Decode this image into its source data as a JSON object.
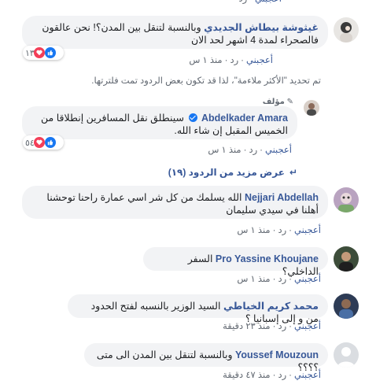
{
  "common": {
    "like": "أعجبني",
    "reply": "رد",
    "dot": "·"
  },
  "comments": [
    {
      "name": "غيثوشة بيطاش الجديدي",
      "text": "وبالنسبة لتنقل بين المدن؟! نحن عالقون فالصحراء لمدة 4 اشهر لحد الان",
      "time": "منذ ١ س",
      "reactions": "١٣"
    },
    {
      "name": "Abdelkader Amara",
      "badge": "مؤلف",
      "text": "سينطلق نقل المسافرين إنطلاقا من الخميس المقبل إن شاء الله.",
      "time": "منذ ١ س",
      "reactions": "٥٤"
    },
    {
      "name": "Nejjari Abdellah",
      "text": "الله يسلمك من كل شر اسي عمارة راحنا توحشنا أهلنا في سيدي سليمان",
      "time": "منذ ١ س"
    },
    {
      "name": "Pro Yassine Khoujane",
      "text": "السفر الداخلي؟",
      "time": "منذ ١ س"
    },
    {
      "name": "محمد كريم الخياطي",
      "text": "السيد الوزير بالنسبه لفتح الحدود من و إلى إسبانيا ؟",
      "time": "منذ ٢٣ دقيقة"
    },
    {
      "name": "Youssef Mouzoun",
      "text": "وبالنسبة لتنقل بين المدن الى متى ؟؟؟؟",
      "time": "منذ ٤٧ دقيقة"
    }
  ],
  "filter_note": "تم تحديد \"الأكثر ملاءمة\"، لذا قد تكون بعض الردود تمت فلترتها.",
  "more_replies": "عرض مزيد من الردود (١٩)"
}
